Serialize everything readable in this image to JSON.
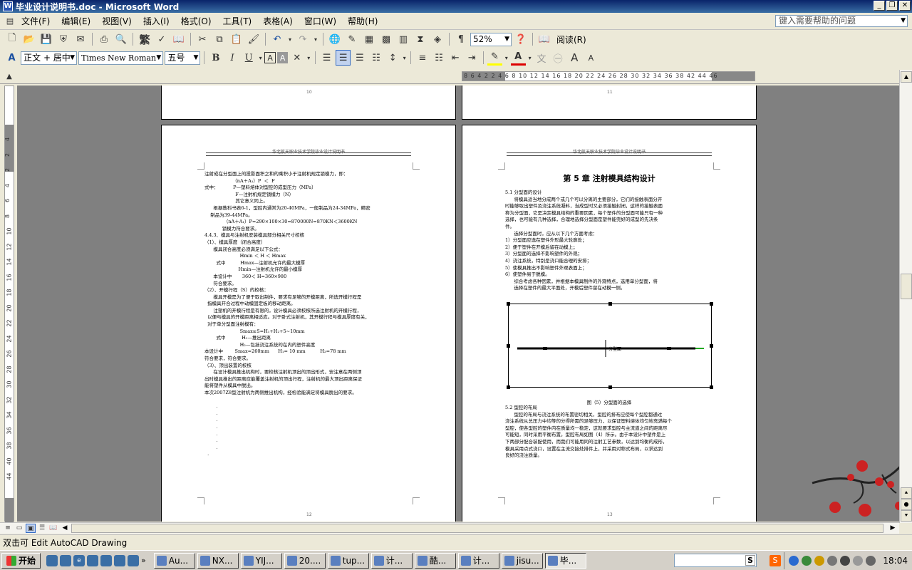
{
  "window": {
    "title": "毕业设计说明书.doc - Microsoft Word",
    "app_icon": "W"
  },
  "menu": [
    "文件(F)",
    "编辑(E)",
    "视图(V)",
    "插入(I)",
    "格式(O)",
    "工具(T)",
    "表格(A)",
    "窗口(W)",
    "帮助(H)"
  ],
  "help_placeholder": "键入需要帮助的问题",
  "toolbar1": {
    "font_convert": "繁",
    "zoom": "52%",
    "read_label": "阅读(R)"
  },
  "toolbar2": {
    "style": "正文 + 居中",
    "font": "Times New Roman",
    "size": "五号",
    "bold": "B",
    "italic": "I",
    "underline": "U"
  },
  "ruler_text": "8  6  4  2      2   4   6   8  10  12  14  16  18  20  22  24  26  28  30  32  34  36  38     42  44  46",
  "vruler_numbers": [
    "4",
    "2",
    "2",
    "4",
    "6",
    "8",
    "10",
    "12",
    "14",
    "16",
    "18",
    "20",
    "22",
    "24",
    "26",
    "28",
    "30",
    "32",
    "34",
    "36",
    "38",
    "40",
    "44"
  ],
  "pages": {
    "top_left_number": "10",
    "top_right_number": "11",
    "left_header": "华北航天职业技术学院毕业设计说明书",
    "right_header": "华北航天职业技术学院毕业设计说明书",
    "left_body": "注射成在分型面上的投影面积之和的乘积小于注射机规定锁模力，即：\n                   （nA＋A₁）P  ＜  F\n式中：          P—塑料熔体对型腔的成型压力（MPa）\n                     F—注射机规定锁模力（N）\n                     其它意义同上。\n      根据教科书表6-1，型腔内通常为20-40MPa，一般制品为24-34MPa，精密\n    制品为39-44MPa。\n             （nA＋A₁）P=290×100×30=870000N=870KN＜3600KN\n            锁模力符合要求。\n4.4.3、模具与注射机安装模具部分相关尺寸校核\n（1）、模具厚度（闭合高度）\n      模具闭合高度必须满足以下公式：\n                        Hmin ＜ H ＜ Hmax\n        式中          Hmax—注射机允许的最大模厚\n                       Hmin—注射机允许的最小模厚\n      本设计中       360＜ H=360×980\n      符合要求。\n（2）、开模行程（S）的校核：\n      模具开模是为了便于取出制件，要求有足够的开模距离，所选开模行程是\n  指模具开合过程中动模固定板的移动距离。\n      注塑机的开模行程是有限的，设计模具必须校核所选注射机的开模行程，\n  以便与模具的开模距离相适应。对于卧式注射机，其开模行程与模具厚度有关，\n  对于单分型面注射模有：\n                        Smax≥S=H₁+H₂+5~10mm\n        式中           H₁—推出距离\n                        H₂—包括浇注系统的在内的塑件高度\n本设计中        Smax=260mm      H₁= 10 mm          H₂=78 mm\n符合要求，符合要求。\n（3）、顶出装置的校核\n      在设计模具推出机构时，要校核注射机顶出的顶出形式，安注意在两侧顶\n出时模具推出的距离应能覆盖注射机的顶出行程，注射机的最大顶出距离保证\n能将塑件从模具中脱出。\n本次2007Z8型注射机为两侧推出机构，经检验能满足将模具脱出的要求。\n\n        .\n        .\n        .\n        .\n        .\n        .\n        .\n  .",
    "left_bottom_number": "12",
    "right_title": "第 5 章   注射模具结构设计",
    "right_body": "5.1 分型面的设计\n      将模具适当地分成两个或几个可以分离的主要部分，它们的接触表面分开\n时能够取出塑件及浇注系统凝料，当成型时又必须接触封闭，这样的接触表面\n称为分型面，它是决定模具结构的重要因素，每个塑件的分型面可能只有一种\n选择，也可能有几种选择，合理地选择分型面是塑件能完好的成型的先决条\n件。\n      选择分型面时，应从以下几个方面考虑：\n1）分型面应选在塑件外形最大轮廓处；\n2）便于塑件在开模后留在动模上；\n3）分型面的选择不影响塑件的外观；\n4）浇注系统，特别是浇口能合理的安排；\n5）使模具推出不影响塑件外观表面上；\n6）使塑件易于脱模。\n      综合考虑各种因素，并根据本模具制件的外观特点，选用单分型面，将\n      选择在塑件的最大平面处，开模后塑件留在动模一侧。",
    "figure_caption": "图（5）分型面的选择",
    "right_body2": "5.2 型腔的布局\n      型腔的布局与浇注系统的布置密切相关，型腔的排布应使每个型腔都通过\n浇注系统从总压力中均等的分得所需的足够压力，以保证塑料熔体均匀地充满每个\n型腔，使各型腔的塑件内在质量均一稳定，这就要求型腔与主流道之间的距离尽\n可能短，同时采用平衡布置。型腔布局如图（4）所示。由于本设计中塑件是上\n下两部分配合装配使用，而我们可能用同的注射工艺参数，以达到均衡的成形，\n模具采用点式浇口，设置在主流交接处排件上，并采用对称式布局，以求达到\n良好的浇注质量。",
    "right_bottom_number": "13",
    "figure_label": "分型面"
  },
  "status": {
    "text": "双击可 Edit AutoCAD Drawing"
  },
  "taskbar": {
    "start": "开始",
    "tasks": [
      "Au...",
      "NX...",
      "YIJ...",
      "20....",
      "tup...",
      "计...",
      "酷...",
      "计...",
      "jisu...",
      "毕..."
    ],
    "clock": "18:04",
    "search_btn": "S",
    "sogou": "S"
  }
}
